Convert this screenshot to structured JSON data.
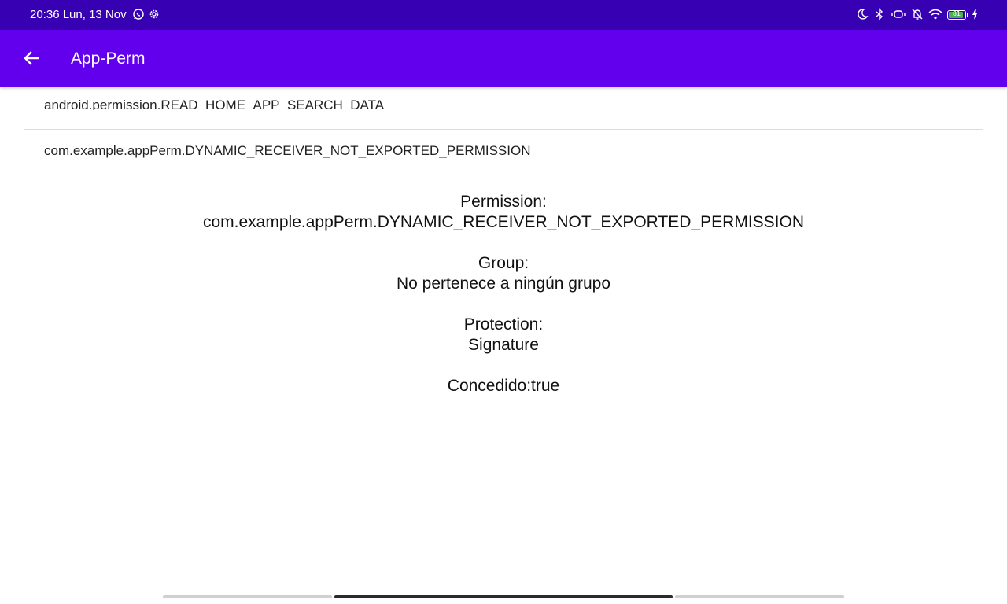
{
  "status_bar": {
    "time_date": "20:36 Lun, 13 Nov",
    "left_icons": [
      "whatsapp-icon",
      "settings-icon"
    ],
    "right_icons": [
      "moon-icon",
      "bluetooth-icon",
      "vibrate-icon",
      "bell-off-icon",
      "wifi-icon"
    ],
    "battery_level": "81",
    "charging": true
  },
  "app_bar": {
    "title": "App-Perm",
    "back_icon": "arrow-back-icon",
    "color": "#6200ee"
  },
  "permission_list": {
    "items": [
      {
        "label": "android.permission.READ_HOME_APP_SEARCH_DATA"
      },
      {
        "label": "com.example.appPerm.DYNAMIC_RECEIVER_NOT_EXPORTED_PERMISSION"
      }
    ]
  },
  "details": {
    "permission_label": "Permission:",
    "permission_value": "com.example.appPerm.DYNAMIC_RECEIVER_NOT_EXPORTED_PERMISSION",
    "group_label": "Group:",
    "group_value": "No pertenece a ningún grupo",
    "protection_label": "Protection:",
    "protection_value": "Signature",
    "granted": "Concedido:true"
  },
  "colors": {
    "status_bar": "#3700b3",
    "app_bar": "#6200ee",
    "battery_fill": "#4caf50"
  }
}
